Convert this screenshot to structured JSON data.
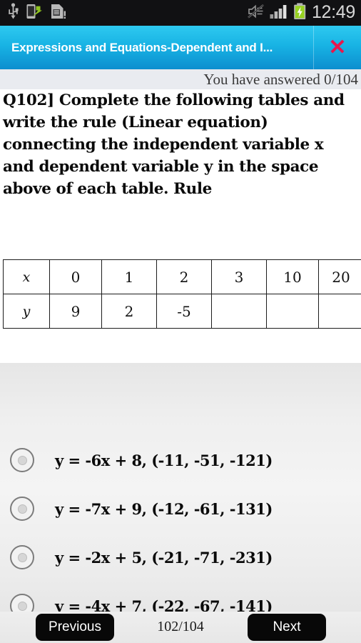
{
  "status_bar": {
    "icons": [
      "usb-icon",
      "usb-transfer-icon",
      "sd-card-icon",
      "mute-icon",
      "signal-bars-icon",
      "battery-charging-icon"
    ],
    "clock": "12:49",
    "background": "#111113",
    "battery_color": "#96d121"
  },
  "title_bar": {
    "title": "Expressions and Equations-Dependent and I...",
    "close_label": "✕",
    "accent_top": "#2ec9f0",
    "accent_bottom": "#0c8ecf",
    "close_color": "#e8174c"
  },
  "progress": {
    "answered_text": "You have answered 0/104"
  },
  "question": {
    "text": "Q102]  Complete the following tables and write the rule (Linear equation) connecting the  independent variable x and dependent variable y in the space above of each table. Rule"
  },
  "table": {
    "rows": [
      {
        "label": "x",
        "cells": [
          "0",
          "1",
          "2",
          "3",
          "10",
          "20"
        ]
      },
      {
        "label": "y",
        "cells": [
          "9",
          "2",
          "-5",
          "",
          "",
          ""
        ]
      }
    ]
  },
  "options": [
    {
      "id": "option-a",
      "text": "y = -6x + 8, (-11, -51, -121)",
      "selected": false
    },
    {
      "id": "option-b",
      "text": "y = -7x + 9, (-12, -61, -131)",
      "selected": false
    },
    {
      "id": "option-c",
      "text": "y = -2x + 5, (-21, -71, -231)",
      "selected": false
    },
    {
      "id": "option-d",
      "text": "y = -4x + 7, (-22, -67, -141)",
      "selected": false
    }
  ],
  "nav": {
    "previous_label": "Previous",
    "next_label": "Next",
    "counter": "102/104"
  }
}
